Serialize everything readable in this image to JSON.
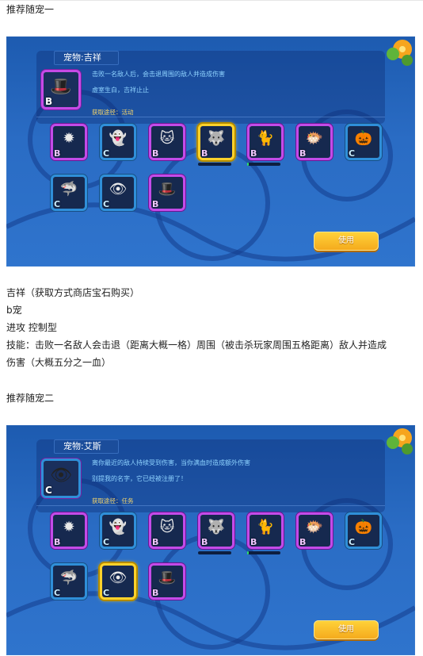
{
  "texts": {
    "heading1": "推荐随宠一",
    "desc_name": "吉祥（获取方式商店宝石购买）",
    "desc_grade": "b宠",
    "desc_type": "进攻 控制型",
    "desc_skill1": "技能：击败一名敌人会击退（距离大概一格）周围（被击杀玩家周围五格距离）敌人并造成",
    "desc_skill2": "伤害（大概五分之一血）",
    "heading2": "推荐随宠二"
  },
  "screens": [
    {
      "pet_label": "宠物:吉祥",
      "skill_line1": "击败一名敌人后，会击退周围的敌人并造成伤害",
      "skill_line2": "虚室生白，吉祥止止",
      "source": "获取途径：活动",
      "big_icon": {
        "grade": "B",
        "glyph": "🎩",
        "icon": "jixiang-doll-icon"
      },
      "use_button": "使用",
      "pets": [
        {
          "grade": "B",
          "glyph": "✹",
          "icon": "spiky-dark-blob-icon",
          "selected": false
        },
        {
          "grade": "C",
          "glyph": "👻",
          "icon": "ghost-icon",
          "selected": false
        },
        {
          "grade": "B",
          "glyph": "🐱",
          "icon": "cat-icon",
          "selected": false
        },
        {
          "grade": "B",
          "glyph": "🐺",
          "icon": "gray-wolf-icon",
          "selected": true,
          "progress": 0
        },
        {
          "grade": "B",
          "glyph": "🐈",
          "icon": "robot-cat-icon",
          "selected": false,
          "progress": 0.05
        },
        {
          "grade": "B",
          "glyph": "🐡",
          "icon": "pufferfish-icon",
          "selected": false
        },
        {
          "grade": "C",
          "glyph": "🎃",
          "icon": "pumpkin-witch-icon",
          "selected": false
        },
        {
          "grade": "C",
          "glyph": "🦈",
          "icon": "red-fin-shark-icon",
          "selected": false
        },
        {
          "grade": "C",
          "glyph": "👁",
          "icon": "blue-eye-monster-icon",
          "selected": false
        },
        {
          "grade": "B",
          "glyph": "🎩",
          "icon": "jixiang-doll-icon",
          "selected": false
        }
      ]
    },
    {
      "pet_label": "宠物:艾斯",
      "skill_line1": "离你最近的敌人持续受到伤害，当你满血时造成额外伤害",
      "skill_line2": "别提我的名字，它已经被注册了！",
      "source": "获取途径：任务",
      "big_icon": {
        "grade": "C",
        "glyph": "👁",
        "icon": "blue-eye-monster-icon"
      },
      "use_button": "使用",
      "pets": [
        {
          "grade": "B",
          "glyph": "✹",
          "icon": "spiky-dark-blob-icon",
          "selected": false
        },
        {
          "grade": "C",
          "glyph": "👻",
          "icon": "ghost-icon",
          "selected": false
        },
        {
          "grade": "B",
          "glyph": "🐱",
          "icon": "cat-icon",
          "selected": false
        },
        {
          "grade": "B",
          "glyph": "🐺",
          "icon": "gray-wolf-icon",
          "selected": false,
          "progress": 0
        },
        {
          "grade": "B",
          "glyph": "🐈",
          "icon": "robot-cat-icon",
          "selected": false,
          "progress": 0.05
        },
        {
          "grade": "B",
          "glyph": "🐡",
          "icon": "pufferfish-icon",
          "selected": false
        },
        {
          "grade": "C",
          "glyph": "🎃",
          "icon": "pumpkin-witch-icon",
          "selected": false
        },
        {
          "grade": "C",
          "glyph": "🦈",
          "icon": "red-fin-shark-icon",
          "selected": false
        },
        {
          "grade": "C",
          "glyph": "👁",
          "icon": "blue-eye-monster-icon",
          "selected": true
        },
        {
          "grade": "B",
          "glyph": "🎩",
          "icon": "jixiang-doll-icon",
          "selected": false
        }
      ]
    }
  ],
  "colors": {
    "grade_b_border": "#c34be8",
    "grade_c_border": "#2f8fd9",
    "selected_border": "#ffd22b",
    "button": "#f4a91c"
  }
}
